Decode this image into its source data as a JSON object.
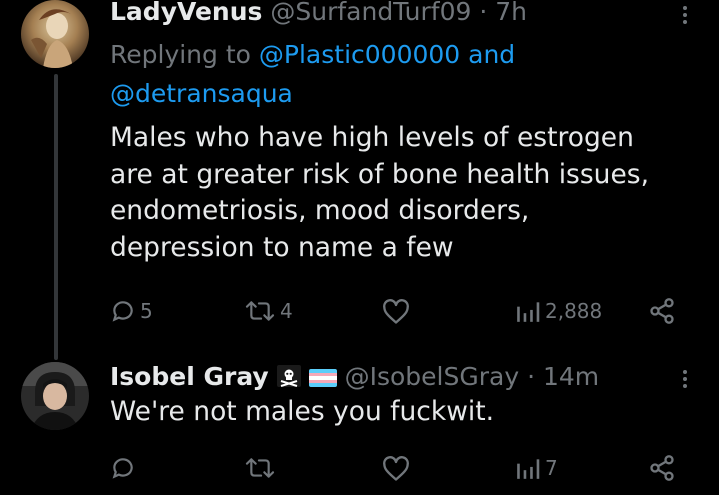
{
  "tweets": [
    {
      "display_name": "LadyVenus",
      "handle": "@SurfandTurf09",
      "separator": "·",
      "time": "7h",
      "replying_prefix": "Replying to",
      "replying_users": "@Plastic000000 and",
      "replying_users_2": "@detransaqua",
      "body_lines": [
        "Males who have high levels of estrogen",
        "are at greater risk of bone health issues,",
        "endometriosis, mood disorders,",
        "depression to name a few"
      ],
      "reply_count": "5",
      "retweet_count": "4",
      "like_count": "",
      "view_count": "2,888"
    },
    {
      "display_name": "Isobel Gray",
      "name_emojis": [
        "pirate-flag",
        "transgender-flag"
      ],
      "handle": "@IsobelSGray",
      "separator": "·",
      "time": "14m",
      "body_lines": [
        "We're not males you fuckwit."
      ],
      "reply_count": "",
      "retweet_count": "",
      "like_count": "",
      "view_count": "7"
    }
  ],
  "colors": {
    "background": "#000000",
    "text": "#e7e9ea",
    "muted": "#71767b",
    "link": "#1d9bf0",
    "thread_line": "#333639",
    "trans_blue": "#5bcefa",
    "trans_pink": "#f5a9b8",
    "trans_white": "#ffffff"
  },
  "icons": {
    "reply": "speech-bubble-icon",
    "retweet": "retweet-arrows-icon",
    "like": "heart-icon",
    "views": "bar-chart-icon",
    "share": "share-nodes-icon",
    "more": "more-dots-icon"
  }
}
